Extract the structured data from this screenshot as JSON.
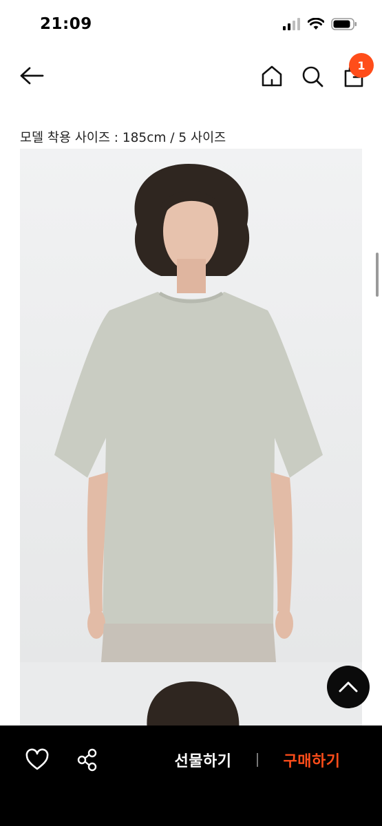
{
  "status_bar": {
    "time": "21:09",
    "icons": [
      "cellular-signal-icon",
      "wifi-icon",
      "battery-icon"
    ]
  },
  "header": {
    "back_icon": "arrow-left-icon",
    "home_icon": "home-icon",
    "search_icon": "search-icon",
    "cart_icon": "shopping-bag-icon",
    "cart_count": "1"
  },
  "product": {
    "size_caption": "모델 착용 사이즈 : 185cm / 5 사이즈",
    "image": "model-wearing-light-grey-short-sleeve-tshirt"
  },
  "floating": {
    "scroll_top_icon": "chevron-up-icon"
  },
  "bottom_bar": {
    "wish_icon": "heart-icon",
    "share_icon": "share-icon",
    "gift_label": "선물하기",
    "buy_label": "구매하기"
  },
  "colors": {
    "accent": "#ff4d1a",
    "bottom_bar": "#000000",
    "image_background": "#edeeef",
    "shirt": "#c9ccc2"
  }
}
